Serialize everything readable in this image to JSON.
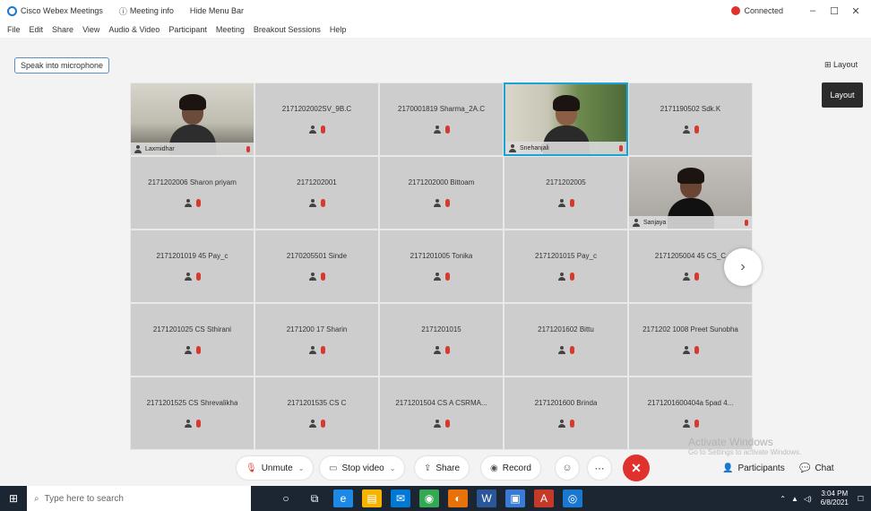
{
  "titlebar": {
    "app_name": "Cisco Webex Meetings",
    "meeting_info": "Meeting info",
    "hide_menu": "Hide Menu Bar",
    "connection_label": "Connected",
    "minimize": "–",
    "maximize": "☐",
    "close": "✕"
  },
  "menu": [
    "File",
    "Edit",
    "Share",
    "View",
    "Audio & Video",
    "Participant",
    "Meeting",
    "Breakout Sessions",
    "Help"
  ],
  "speak_button": "Speak into microphone",
  "layout_label": "Layout",
  "layout_button": "Layout",
  "tiles": [
    {
      "type": "video",
      "name": "Laxmidhar",
      "scene": "room"
    },
    {
      "type": "name",
      "name": "2171202002SV_9B.C"
    },
    {
      "type": "name",
      "name": "2170001819 Sharma_2A.C"
    },
    {
      "type": "video",
      "name": "Snehanjali",
      "scene": "outdoor",
      "selected": true
    },
    {
      "type": "name",
      "name": "2171190502 Sdk.K"
    },
    {
      "type": "name",
      "name": "2171202006 Sharon priyam"
    },
    {
      "type": "name",
      "name": "2171202001"
    },
    {
      "type": "name",
      "name": "2171202000 Bittoam"
    },
    {
      "type": "name",
      "name": "2171202005"
    },
    {
      "type": "video",
      "name": "Sanjaya",
      "scene": "indoor"
    },
    {
      "type": "name",
      "name": "2171201019 45 Pay_c"
    },
    {
      "type": "name",
      "name": "2170205501 Sinde"
    },
    {
      "type": "name",
      "name": "2171201005 Tonika"
    },
    {
      "type": "name",
      "name": "2171201015 Pay_c"
    },
    {
      "type": "name",
      "name": "2171205004 45 CS_C"
    },
    {
      "type": "name",
      "name": "2171201025 CS Sthirani"
    },
    {
      "type": "name",
      "name": "2171200 17 Sharin"
    },
    {
      "type": "name",
      "name": "2171201015"
    },
    {
      "type": "name",
      "name": "2171201602 Bittu"
    },
    {
      "type": "name",
      "name": "2171202 1008 Preet Sunobha"
    },
    {
      "type": "name",
      "name": "2171201525 CS Shrevalikha"
    },
    {
      "type": "name",
      "name": "2171201535 CS C"
    },
    {
      "type": "name",
      "name": "2171201504 CS A CSRMA..."
    },
    {
      "type": "name",
      "name": "2171201600 Brinda"
    },
    {
      "type": "name",
      "name": "2171201600404a 5pad 4..."
    }
  ],
  "next_page": "›",
  "controls": {
    "unmute": "Unmute",
    "stop_video": "Stop video",
    "share": "Share",
    "record": "Record",
    "participants": "Participants",
    "chat": "Chat"
  },
  "watermark": {
    "title": "Activate Windows",
    "subtitle": "Go to Settings to activate Windows."
  },
  "taskbar": {
    "search_placeholder": "Type here to search",
    "time": "3:04 PM",
    "date": "6/8/2021"
  }
}
